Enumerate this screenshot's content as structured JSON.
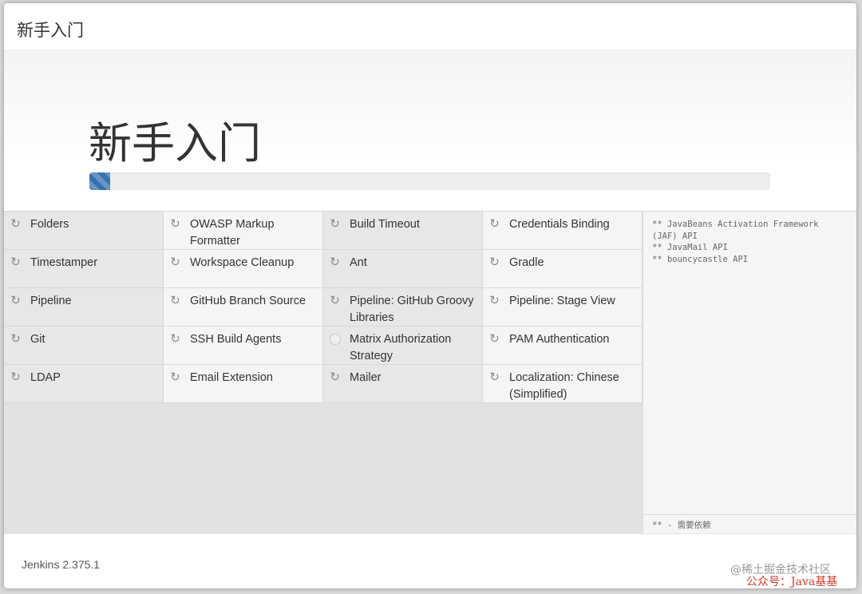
{
  "dialog": {
    "header_title": "新手入门",
    "hero_title": "新手入门",
    "progress_fraction": 0.03
  },
  "plugins": [
    {
      "name": "Folders",
      "status": "installing",
      "icon": "refresh-icon"
    },
    {
      "name": "OWASP Markup Formatter",
      "status": "installing",
      "icon": "refresh-icon"
    },
    {
      "name": "Build Timeout",
      "status": "installing",
      "icon": "refresh-icon"
    },
    {
      "name": "Credentials Binding",
      "status": "installing",
      "icon": "refresh-icon"
    },
    {
      "name": "Timestamper",
      "status": "installing",
      "icon": "refresh-icon"
    },
    {
      "name": "Workspace Cleanup",
      "status": "installing",
      "icon": "refresh-icon"
    },
    {
      "name": "Ant",
      "status": "installing",
      "icon": "refresh-icon"
    },
    {
      "name": "Gradle",
      "status": "installing",
      "icon": "refresh-icon"
    },
    {
      "name": "Pipeline",
      "status": "installing",
      "icon": "refresh-icon"
    },
    {
      "name": "GitHub Branch Source",
      "status": "installing",
      "icon": "refresh-icon"
    },
    {
      "name": "Pipeline: GitHub Groovy Libraries",
      "status": "installing",
      "icon": "refresh-icon"
    },
    {
      "name": "Pipeline: Stage View",
      "status": "installing",
      "icon": "refresh-icon"
    },
    {
      "name": "Git",
      "status": "installing",
      "icon": "refresh-icon"
    },
    {
      "name": "SSH Build Agents",
      "status": "installing",
      "icon": "refresh-icon"
    },
    {
      "name": "Matrix Authorization Strategy",
      "status": "pending",
      "icon": "pending-icon"
    },
    {
      "name": "PAM Authentication",
      "status": "installing",
      "icon": "refresh-icon"
    },
    {
      "name": "LDAP",
      "status": "installing",
      "icon": "refresh-icon"
    },
    {
      "name": "Email Extension",
      "status": "installing",
      "icon": "refresh-icon"
    },
    {
      "name": "Mailer",
      "status": "installing",
      "icon": "refresh-icon"
    },
    {
      "name": "Localization: Chinese (Simplified)",
      "status": "installing",
      "icon": "refresh-icon"
    }
  ],
  "log": {
    "text": "** JavaBeans Activation Framework (JAF) API\n** JavaMail API\n** bouncycastle API",
    "footer": "** - 需要依赖"
  },
  "footer": {
    "version": "Jenkins 2.375.1"
  },
  "watermark": {
    "line1": "@稀土掘金技术社区",
    "line2": "公众号：Java基基"
  },
  "colors": {
    "progress": "#3572b0",
    "text": "#333333"
  }
}
